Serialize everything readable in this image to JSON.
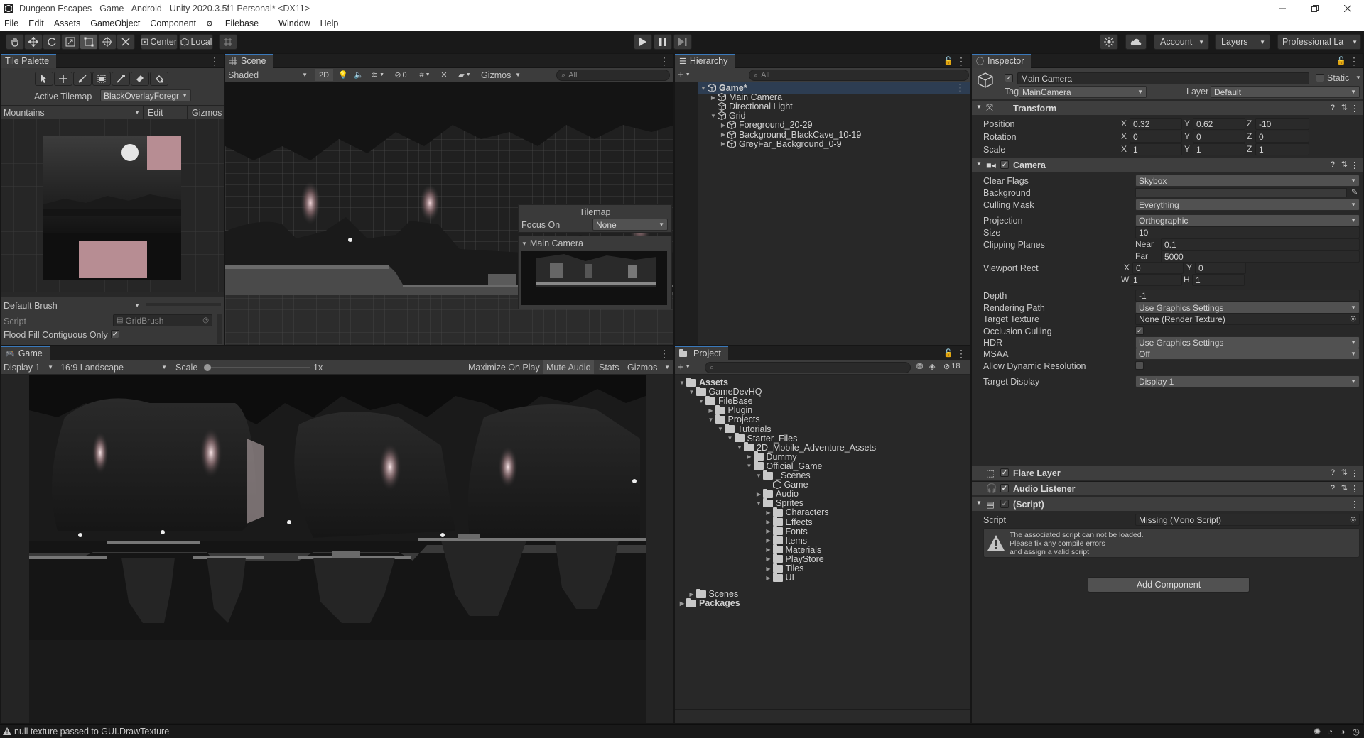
{
  "window": {
    "title": "Dungeon Escapes - Game - Android - Unity 2020.3.5f1 Personal* <DX11>"
  },
  "menu": [
    "File",
    "Edit",
    "Assets",
    "GameObject",
    "Component",
    "Filebase",
    "Window",
    "Help"
  ],
  "toolbar": {
    "pivot": "Center",
    "space": "Local",
    "account": "Account",
    "layers": "Layers",
    "layout": "Professional La"
  },
  "tile_palette": {
    "tab": "Tile Palette",
    "active_tilemap_label": "Active Tilemap",
    "active_tilemap_value": "BlackOverlayForegr",
    "palette": "Mountains",
    "edit": "Edit",
    "gizmos": "Gizmos",
    "brush": "Default Brush",
    "script_label": "Script",
    "script_value": "GridBrush",
    "flood_fill": "Flood Fill Contiguous Only"
  },
  "scene": {
    "tab": "Scene",
    "shading": "Shaded",
    "mode_2d": "2D",
    "hidden_count": "0",
    "gizmos": "Gizmos",
    "search_placeholder": "All",
    "tilemap_overlay_title": "Tilemap",
    "focus_on_label": "Focus On",
    "focus_on_value": "None",
    "camera_preview_title": "Main Camera"
  },
  "game": {
    "tab": "Game",
    "display": "Display 1",
    "aspect": "16:9 Landscape",
    "scale_label": "Scale",
    "scale_value": "1x",
    "maximize": "Maximize On Play",
    "mute": "Mute Audio",
    "stats": "Stats",
    "gizmos": "Gizmos"
  },
  "hierarchy": {
    "tab": "Hierarchy",
    "search_placeholder": "All",
    "items": [
      {
        "label": "Game*",
        "level": 0,
        "bold": true,
        "twirl": "▼"
      },
      {
        "label": "Main Camera",
        "level": 1,
        "twirl": "▶"
      },
      {
        "label": "Directional Light",
        "level": 1,
        "twirl": ""
      },
      {
        "label": "Grid",
        "level": 1,
        "twirl": "▼"
      },
      {
        "label": "Foreground_20-29",
        "level": 2,
        "twirl": "▶"
      },
      {
        "label": "Background_BlackCave_10-19",
        "level": 2,
        "twirl": "▶"
      },
      {
        "label": "GreyFar_Background_0-9",
        "level": 2,
        "twirl": "▶"
      }
    ]
  },
  "project": {
    "tab": "Project",
    "hidden_count": "18",
    "tree": [
      {
        "label": "Assets",
        "level": 0,
        "bold": true,
        "twirl": "▼"
      },
      {
        "label": "GameDevHQ",
        "level": 1,
        "twirl": "▼"
      },
      {
        "label": "FileBase",
        "level": 2,
        "twirl": "▼"
      },
      {
        "label": "Plugin",
        "level": 3,
        "twirl": "▶"
      },
      {
        "label": "Projects",
        "level": 3,
        "twirl": "▼"
      },
      {
        "label": "Tutorials",
        "level": 4,
        "twirl": "▼"
      },
      {
        "label": "Starter_Files",
        "level": 5,
        "twirl": "▼"
      },
      {
        "label": "2D_Mobile_Adventure_Assets",
        "level": 6,
        "twirl": "▼"
      },
      {
        "label": "Dummy",
        "level": 7,
        "twirl": "▶"
      },
      {
        "label": "Official_Game",
        "level": 7,
        "twirl": "▼"
      },
      {
        "label": "_Scenes",
        "level": 8,
        "twirl": "▼"
      },
      {
        "label": "Game",
        "level": 9,
        "twirl": "",
        "scene": true
      },
      {
        "label": "Audio",
        "level": 8,
        "twirl": "▶"
      },
      {
        "label": "Sprites",
        "level": 8,
        "twirl": "▼"
      },
      {
        "label": "Characters",
        "level": 9,
        "twirl": "▶"
      },
      {
        "label": "Effects",
        "level": 9,
        "twirl": "▶"
      },
      {
        "label": "Fonts",
        "level": 9,
        "twirl": "▶"
      },
      {
        "label": "Items",
        "level": 9,
        "twirl": "▶"
      },
      {
        "label": "Materials",
        "level": 9,
        "twirl": "▶"
      },
      {
        "label": "PlayStore",
        "level": 9,
        "twirl": "▶"
      },
      {
        "label": "Tiles",
        "level": 9,
        "twirl": "▶"
      },
      {
        "label": "UI",
        "level": 9,
        "twirl": "▶"
      },
      {
        "label": "Scenes",
        "level": 1,
        "twirl": "▶",
        "gap": true
      },
      {
        "label": "Packages",
        "level": 0,
        "bold": true,
        "twirl": "▶"
      }
    ]
  },
  "inspector": {
    "tab": "Inspector",
    "object_name": "Main Camera",
    "static": "Static",
    "tag_label": "Tag",
    "tag_value": "MainCamera",
    "layer_label": "Layer",
    "layer_value": "Default",
    "transform": {
      "title": "Transform",
      "position": {
        "label": "Position",
        "x": "0.32",
        "y": "0.62",
        "z": "-10"
      },
      "rotation": {
        "label": "Rotation",
        "x": "0",
        "y": "0",
        "z": "0"
      },
      "scale": {
        "label": "Scale",
        "x": "1",
        "y": "1",
        "z": "1"
      }
    },
    "camera": {
      "title": "Camera",
      "rows": [
        {
          "label": "Clear Flags",
          "value": "Skybox",
          "kind": "dd"
        },
        {
          "label": "Background",
          "value": "",
          "kind": "color"
        },
        {
          "label": "Culling Mask",
          "value": "Everything",
          "kind": "dd"
        },
        {
          "label": "Projection",
          "value": "Orthographic",
          "kind": "dd"
        },
        {
          "label": "Size",
          "value": "10",
          "kind": "field"
        }
      ],
      "clipping_label": "Clipping Planes",
      "near_label": "Near",
      "near_value": "0.1",
      "far_label": "Far",
      "far_value": "5000",
      "viewport_label": "Viewport Rect",
      "vx": "0",
      "vy": "0",
      "vw": "1",
      "vh": "1",
      "rows2": [
        {
          "label": "Depth",
          "value": "-1",
          "kind": "field"
        },
        {
          "label": "Rendering Path",
          "value": "Use Graphics Settings",
          "kind": "dd"
        },
        {
          "label": "Target Texture",
          "value": "None (Render Texture)",
          "kind": "obj"
        },
        {
          "label": "Occlusion Culling",
          "value": "✓",
          "kind": "check"
        },
        {
          "label": "HDR",
          "value": "Use Graphics Settings",
          "kind": "dd"
        },
        {
          "label": "MSAA",
          "value": "Off",
          "kind": "dd"
        },
        {
          "label": "Allow Dynamic Resolution",
          "value": "",
          "kind": "check"
        },
        {
          "label": "Target Display",
          "value": "Display 1",
          "kind": "dd"
        }
      ]
    },
    "flare_layer": "Flare Layer",
    "audio_listener": "Audio Listener",
    "script_component": "(Script)",
    "script_label": "Script",
    "script_value": "Missing (Mono Script)",
    "warning_lines": [
      "The associated script can not be loaded.",
      "Please fix any compile errors",
      "and assign a valid script."
    ],
    "add_component": "Add Component"
  },
  "status": {
    "message": "null texture passed to GUI.DrawTexture"
  }
}
